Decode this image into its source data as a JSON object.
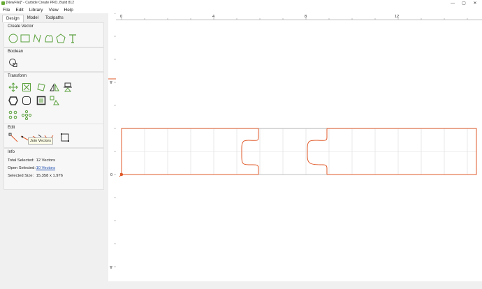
{
  "window": {
    "title": "[NewFile]* - Carbide Create PRO, Build 812"
  },
  "window_controls": {
    "minimize": "—",
    "maximize": "▢",
    "close": "✕"
  },
  "menu": [
    "File",
    "Edit",
    "Library",
    "View",
    "Help"
  ],
  "tabs": [
    "Design",
    "Model",
    "Toolpaths"
  ],
  "sections": {
    "create_vector": "Create Vector",
    "boolean": "Boolean",
    "transform": "Transform",
    "edit": "Edit",
    "info": "Info"
  },
  "tooltip": "Join Vectors",
  "info": {
    "total_selected_label": "Total Selected:",
    "total_selected_value": "12 Vectors",
    "open_selected_label": "Open Selected:",
    "open_selected_value": "10 Vectors",
    "selected_size_label": "Selected Size:",
    "selected_size_value": "15.358 x 1.976"
  },
  "ruler": {
    "h_labels": [
      "0",
      "4",
      "8",
      "12"
    ],
    "v_labels": [
      "0"
    ]
  },
  "colors": {
    "accent": "#e05a2a",
    "icon": "#5aa03c",
    "grid": "#d8d8d8",
    "link": "#1f4fb0"
  }
}
